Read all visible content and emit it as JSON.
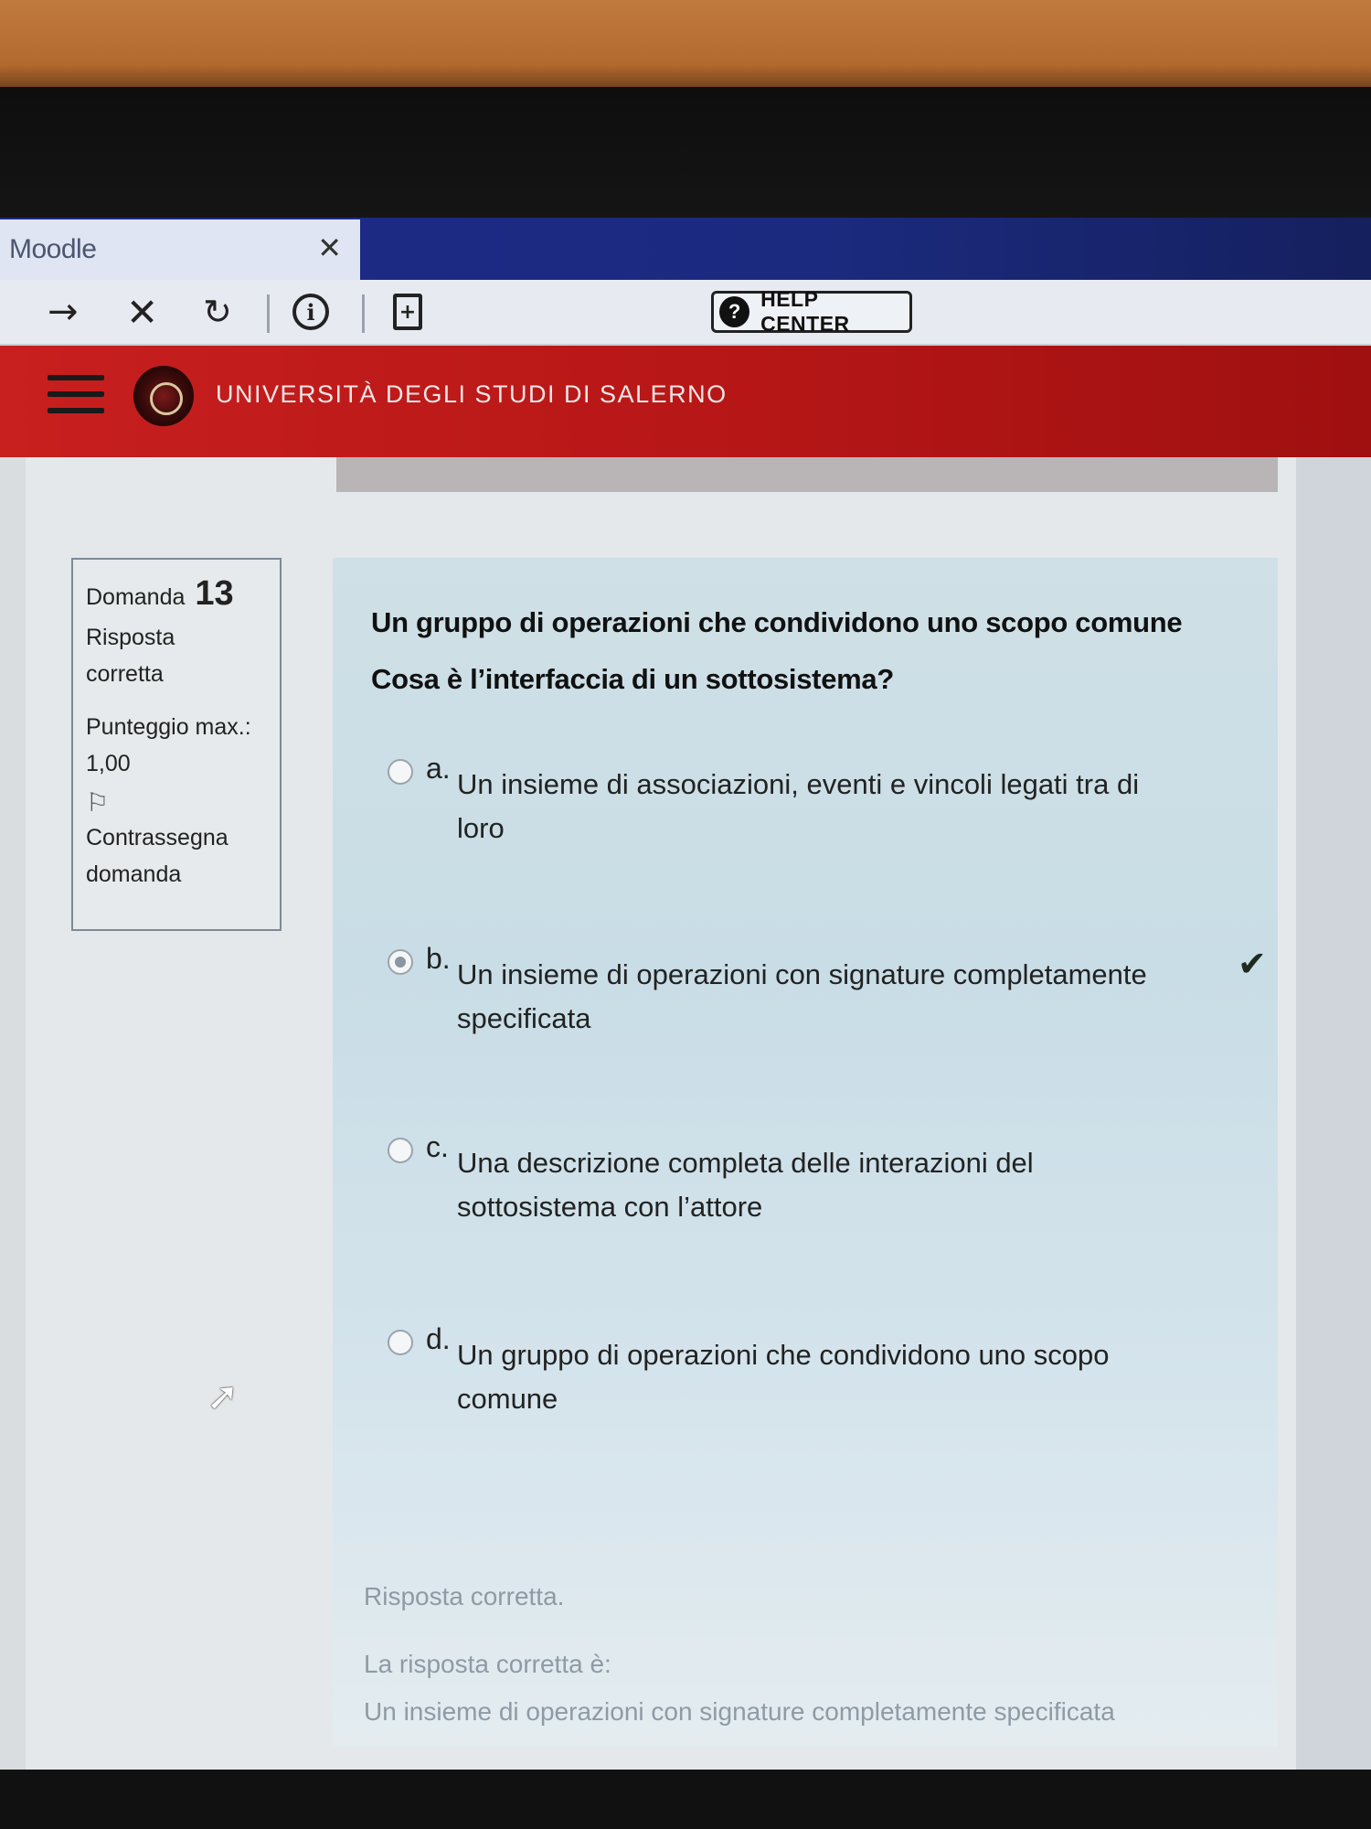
{
  "browser": {
    "tab_title": "Moodle",
    "tab_close_icon": "✕",
    "nav": {
      "forward_icon": "→",
      "stop_icon": "✕",
      "reload_icon": "↻",
      "info_icon": "i",
      "page_icon": "+"
    },
    "help_center": {
      "icon": "?",
      "label": "HELP CENTER"
    }
  },
  "header": {
    "university_name": "UNIVERSITÀ DEGLI STUDI DI SALERNO"
  },
  "question_info": {
    "label": "Domanda",
    "number": "13",
    "status_line1": "Risposta",
    "status_line2": "corretta",
    "score_line1": "Punteggio max.:",
    "score_line2": "1,00",
    "flag_line1": "Contrassegna",
    "flag_line2": "domanda"
  },
  "question": {
    "line1": "Un gruppo di operazioni che condividono uno scopo comune",
    "line2": "Cosa è l’interfaccia di un sottosistema?",
    "options": [
      {
        "letter": "a.",
        "text": "Un insieme di associazioni, eventi e vincoli legati tra di loro",
        "selected": false,
        "correct_mark": false
      },
      {
        "letter": "b.",
        "text": "Un insieme di operazioni con signature completamente specificata",
        "selected": true,
        "correct_mark": true
      },
      {
        "letter": "c.",
        "text": "Una descrizione completa delle interazioni del sottosistema con l’attore",
        "selected": false,
        "correct_mark": false
      },
      {
        "letter": "d.",
        "text": "Un gruppo di operazioni che condividono uno scopo comune",
        "selected": false,
        "correct_mark": false
      }
    ]
  },
  "feedback": {
    "result": "Risposta corretta.",
    "correct_label": "La risposta corretta è:",
    "correct_answer": "Un insieme di operazioni con signature completamente specificata"
  },
  "colors": {
    "tabstrip": "#1d2a8a",
    "university_red": "#c81f1f",
    "question_panel": "#cfe0e6"
  }
}
